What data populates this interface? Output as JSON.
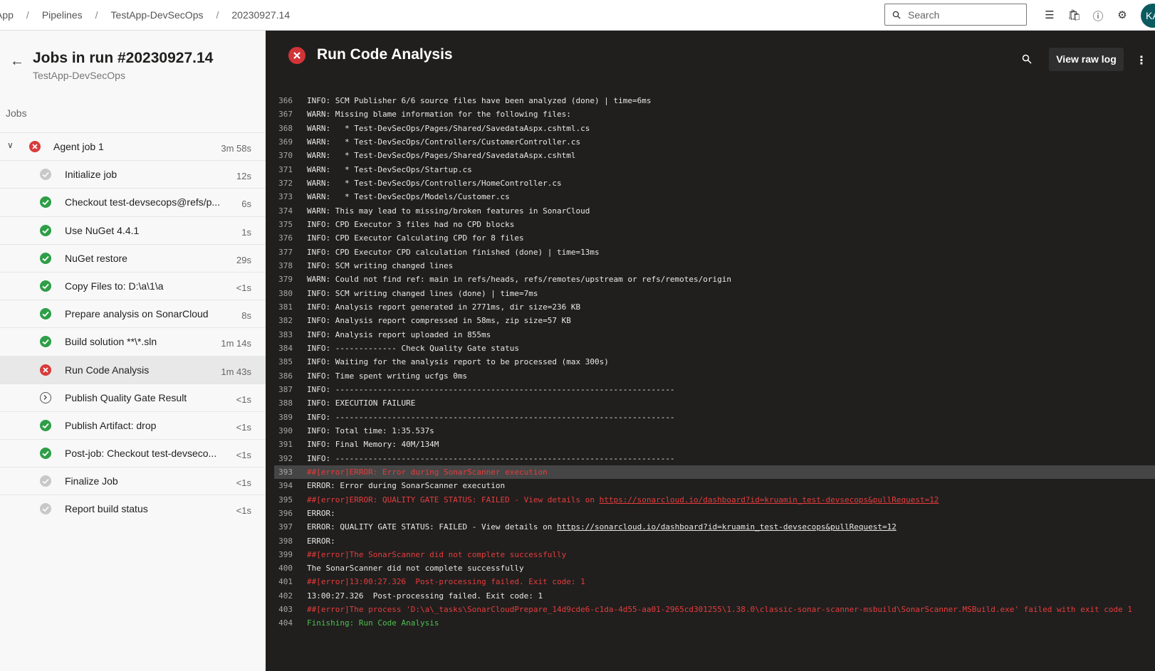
{
  "breadcrumb": [
    "App",
    "Pipelines",
    "TestApp-DevSecOps",
    "20230927.14"
  ],
  "search": {
    "placeholder": "Search"
  },
  "user": {
    "initials": "KA"
  },
  "left": {
    "title": "Jobs in run #20230927.14",
    "subtitle": "TestApp-DevSecOps",
    "section": "Jobs",
    "agent": {
      "label": "Agent job 1",
      "duration": "3m 58s",
      "status": "failed"
    },
    "steps": [
      {
        "label": "Initialize job",
        "duration": "12s",
        "status": "skipped"
      },
      {
        "label": "Checkout test-devsecops@refs/p...",
        "duration": "6s",
        "status": "succeeded"
      },
      {
        "label": "Use NuGet 4.4.1",
        "duration": "1s",
        "status": "succeeded"
      },
      {
        "label": "NuGet restore",
        "duration": "29s",
        "status": "succeeded"
      },
      {
        "label": "Copy Files to: D:\\a\\1\\a",
        "duration": "<1s",
        "status": "succeeded"
      },
      {
        "label": "Prepare analysis on SonarCloud",
        "duration": "8s",
        "status": "succeeded"
      },
      {
        "label": "Build solution **\\*.sln",
        "duration": "1m 14s",
        "status": "succeeded"
      },
      {
        "label": "Run Code Analysis",
        "duration": "1m 43s",
        "status": "failed",
        "selected": true
      },
      {
        "label": "Publish Quality Gate Result",
        "duration": "<1s",
        "status": "pending"
      },
      {
        "label": "Publish Artifact: drop",
        "duration": "<1s",
        "status": "succeeded"
      },
      {
        "label": "Post-job: Checkout test-devseco...",
        "duration": "<1s",
        "status": "succeeded"
      },
      {
        "label": "Finalize Job",
        "duration": "<1s",
        "status": "skipped"
      },
      {
        "label": "Report build status",
        "duration": "<1s",
        "status": "skipped"
      }
    ]
  },
  "main": {
    "title": "Run Code Analysis",
    "view_raw": "View raw log",
    "lines": [
      {
        "n": "366",
        "t": "INFO: SCM Publisher 6/6 source files have been analyzed (done) | time=6ms"
      },
      {
        "n": "367",
        "t": "WARN: Missing blame information for the following files:"
      },
      {
        "n": "368",
        "t": "WARN:   * Test-DevSecOps/Pages/Shared/SavedataAspx.cshtml.cs"
      },
      {
        "n": "369",
        "t": "WARN:   * Test-DevSecOps/Controllers/CustomerController.cs"
      },
      {
        "n": "370",
        "t": "WARN:   * Test-DevSecOps/Pages/Shared/SavedataAspx.cshtml"
      },
      {
        "n": "371",
        "t": "WARN:   * Test-DevSecOps/Startup.cs"
      },
      {
        "n": "372",
        "t": "WARN:   * Test-DevSecOps/Controllers/HomeController.cs"
      },
      {
        "n": "373",
        "t": "WARN:   * Test-DevSecOps/Models/Customer.cs"
      },
      {
        "n": "374",
        "t": "WARN: This may lead to missing/broken features in SonarCloud"
      },
      {
        "n": "375",
        "t": "INFO: CPD Executor 3 files had no CPD blocks"
      },
      {
        "n": "376",
        "t": "INFO: CPD Executor Calculating CPD for 8 files"
      },
      {
        "n": "377",
        "t": "INFO: CPD Executor CPD calculation finished (done) | time=13ms"
      },
      {
        "n": "378",
        "t": "INFO: SCM writing changed lines"
      },
      {
        "n": "379",
        "t": "WARN: Could not find ref: main in refs/heads, refs/remotes/upstream or refs/remotes/origin"
      },
      {
        "n": "380",
        "t": "INFO: SCM writing changed lines (done) | time=7ms"
      },
      {
        "n": "381",
        "t": "INFO: Analysis report generated in 2771ms, dir size=236 KB"
      },
      {
        "n": "382",
        "t": "INFO: Analysis report compressed in 58ms, zip size=57 KB"
      },
      {
        "n": "383",
        "t": "INFO: Analysis report uploaded in 855ms"
      },
      {
        "n": "384",
        "t": "INFO: ------------- Check Quality Gate status"
      },
      {
        "n": "385",
        "t": "INFO: Waiting for the analysis report to be processed (max 300s)"
      },
      {
        "n": "386",
        "t": "INFO: Time spent writing ucfgs 0ms"
      },
      {
        "n": "387",
        "t": "INFO: ------------------------------------------------------------------------"
      },
      {
        "n": "388",
        "t": "INFO: EXECUTION FAILURE"
      },
      {
        "n": "389",
        "t": "INFO: ------------------------------------------------------------------------"
      },
      {
        "n": "390",
        "t": "INFO: Total time: 1:35.537s"
      },
      {
        "n": "391",
        "t": "INFO: Final Memory: 40M/134M"
      },
      {
        "n": "392",
        "t": "INFO: ------------------------------------------------------------------------"
      },
      {
        "n": "393",
        "t": "##[error]ERROR: Error during SonarScanner execution",
        "type": "error",
        "highlight": true
      },
      {
        "n": "394",
        "t": "ERROR: Error during SonarScanner execution"
      },
      {
        "n": "395",
        "t": "##[error]ERROR: QUALITY GATE STATUS: FAILED - View details on ",
        "link": "https://sonarcloud.io/dashboard?id=kruamin_test-devsecops&pullRequest=12",
        "type": "error"
      },
      {
        "n": "396",
        "t": "ERROR:"
      },
      {
        "n": "397",
        "t": "ERROR: QUALITY GATE STATUS: FAILED - View details on ",
        "link": "https://sonarcloud.io/dashboard?id=kruamin_test-devsecops&pullRequest=12"
      },
      {
        "n": "398",
        "t": "ERROR:"
      },
      {
        "n": "399",
        "t": "##[error]The SonarScanner did not complete successfully",
        "type": "error"
      },
      {
        "n": "400",
        "t": "The SonarScanner did not complete successfully"
      },
      {
        "n": "401",
        "t": "##[error]13:00:27.326  Post-processing failed. Exit code: 1",
        "type": "error"
      },
      {
        "n": "402",
        "t": "13:00:27.326  Post-processing failed. Exit code: 1"
      },
      {
        "n": "403",
        "t": "##[error]The process 'D:\\a\\_tasks\\SonarCloudPrepare_14d9cde6-c1da-4d55-aa01-2965cd301255\\1.38.0\\classic-sonar-scanner-msbuild\\SonarScanner.MSBuild.exe' failed with exit code 1",
        "type": "error"
      },
      {
        "n": "404",
        "t": "Finishing: Run Code Analysis",
        "type": "finish"
      }
    ]
  },
  "colors": {
    "success": "#2e9e47",
    "failure": "#d13438",
    "error_text": "#e63c3c",
    "finish_text": "#4ec04e",
    "avatar": "#0b5a5f"
  }
}
